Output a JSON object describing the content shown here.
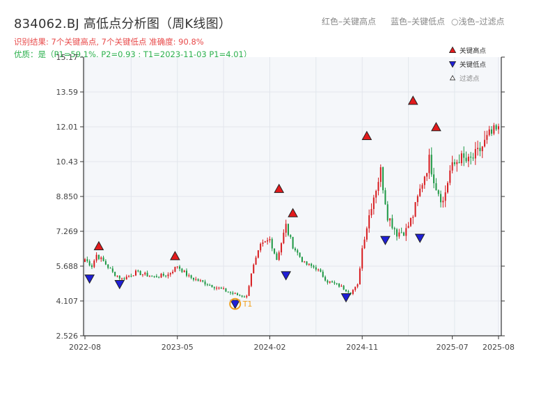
{
  "title": "834062.BJ 高低点分析图（周K线图）",
  "subtitle_result": "识别结果: 7个关键高点, 7个关键低点  准确度: 90.8%",
  "subtitle_quality": "优质：是（P1=59.1%, P2=0.93 ; T1=2023-11-03 P1=4.01）",
  "header_legend": {
    "red": "红色–关键高点",
    "blue": "蓝色–关键低点",
    "light": "○浅色–过滤点"
  },
  "colors": {
    "up": "#d7191c",
    "down": "#1a9641",
    "high_marker": "#e31a1c",
    "low_marker": "#1f1fd6",
    "t1_ring": "#f0a020",
    "plot_bg": "#f5f7fa",
    "grid": "#e2e6ec"
  },
  "chart_data": {
    "type": "candlestick",
    "ylim": [
      2.526,
      15.17
    ],
    "yticks": [
      "15.17",
      "13.59",
      "12.01",
      "10.43",
      "8.850",
      "7.269",
      "5.688",
      "4.107",
      "2.526"
    ],
    "xticks": [
      "2022-08",
      "2023-05",
      "2024-02",
      "2024-11",
      "2025-07",
      "2025-08"
    ],
    "legend": {
      "high": "关键高点",
      "low": "关键低点",
      "filtered": "过滤点"
    },
    "t1_label": "T1",
    "anchors": [
      {
        "w": 0,
        "p": 6.0
      },
      {
        "w": 3,
        "p": 5.7
      },
      {
        "w": 5,
        "p": 6.2
      },
      {
        "w": 8,
        "p": 5.9
      },
      {
        "w": 12,
        "p": 5.4
      },
      {
        "w": 16,
        "p": 5.1
      },
      {
        "w": 22,
        "p": 5.4
      },
      {
        "w": 30,
        "p": 5.2
      },
      {
        "w": 36,
        "p": 5.3
      },
      {
        "w": 40,
        "p": 5.7
      },
      {
        "w": 45,
        "p": 5.2
      },
      {
        "w": 55,
        "p": 4.8
      },
      {
        "w": 65,
        "p": 4.4
      },
      {
        "w": 70,
        "p": 4.3
      },
      {
        "w": 72,
        "p": 5.4
      },
      {
        "w": 76,
        "p": 6.6
      },
      {
        "w": 80,
        "p": 6.9
      },
      {
        "w": 83,
        "p": 6.0
      },
      {
        "w": 87,
        "p": 7.5
      },
      {
        "w": 90,
        "p": 6.6
      },
      {
        "w": 95,
        "p": 5.8
      },
      {
        "w": 100,
        "p": 5.6
      },
      {
        "w": 105,
        "p": 5.0
      },
      {
        "w": 110,
        "p": 4.8
      },
      {
        "w": 115,
        "p": 4.5
      },
      {
        "w": 118,
        "p": 4.8
      },
      {
        "w": 120,
        "p": 6.5
      },
      {
        "w": 124,
        "p": 8.5
      },
      {
        "w": 128,
        "p": 10.0
      },
      {
        "w": 131,
        "p": 8.0
      },
      {
        "w": 135,
        "p": 7.2
      },
      {
        "w": 139,
        "p": 7.3
      },
      {
        "w": 142,
        "p": 8.0
      },
      {
        "w": 146,
        "p": 9.5
      },
      {
        "w": 149,
        "p": 10.5
      },
      {
        "w": 152,
        "p": 9.3
      },
      {
        "w": 155,
        "p": 8.6
      },
      {
        "w": 158,
        "p": 10.0
      },
      {
        "w": 162,
        "p": 10.6
      },
      {
        "w": 166,
        "p": 10.4
      },
      {
        "w": 170,
        "p": 10.8
      },
      {
        "w": 175,
        "p": 11.6
      },
      {
        "w": 178,
        "p": 11.8
      }
    ],
    "highs": [
      {
        "w": 6,
        "p": 6.4
      },
      {
        "w": 39,
        "p": 5.95
      },
      {
        "w": 84,
        "p": 9.0
      },
      {
        "w": 90,
        "p": 7.9
      },
      {
        "w": 122,
        "p": 11.4
      },
      {
        "w": 142,
        "p": 13.0
      },
      {
        "w": 152,
        "p": 11.8
      }
    ],
    "lows": [
      {
        "w": 2,
        "p": 5.25
      },
      {
        "w": 15,
        "p": 5.0
      },
      {
        "w": 65,
        "p": 4.1
      },
      {
        "w": 87,
        "p": 5.4
      },
      {
        "w": 113,
        "p": 4.4
      },
      {
        "w": 130,
        "p": 7.0
      },
      {
        "w": 145,
        "p": 7.1
      }
    ],
    "t1": {
      "w": 65,
      "p": 4.1
    }
  }
}
